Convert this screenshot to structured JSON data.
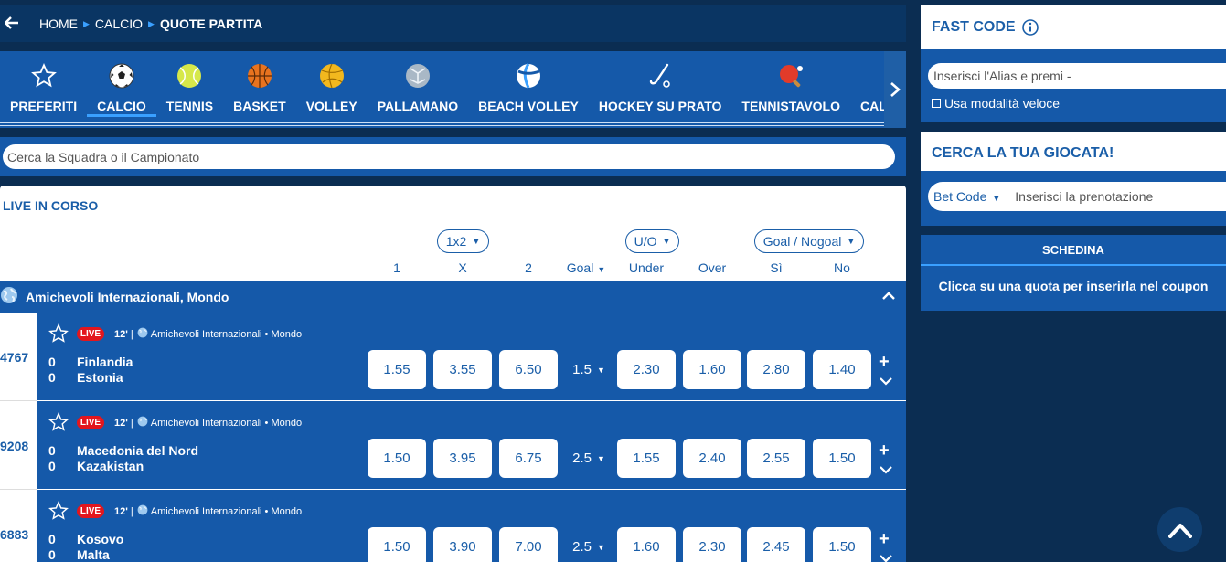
{
  "breadcrumb": {
    "back_icon": "arrow-left-icon",
    "items": [
      "HOME",
      "CALCIO",
      "QUOTE PARTITA"
    ]
  },
  "sports": [
    {
      "label": "PREFERITI",
      "icon": "star-icon"
    },
    {
      "label": "CALCIO",
      "icon": "soccer-ball-icon"
    },
    {
      "label": "TENNIS",
      "icon": "tennis-ball-icon"
    },
    {
      "label": "BASKET",
      "icon": "basketball-icon"
    },
    {
      "label": "VOLLEY",
      "icon": "volleyball-icon"
    },
    {
      "label": "PALLAMANO",
      "icon": "handball-icon"
    },
    {
      "label": "BEACH VOLLEY",
      "icon": "beach-volley-icon"
    },
    {
      "label": "HOCKEY SU PRATO",
      "icon": "hockey-stick-icon"
    },
    {
      "label": "TENNISTAVOLO",
      "icon": "ping-pong-icon"
    },
    {
      "label": "CALENDARIO",
      "icon": "calendar-icon"
    }
  ],
  "active_sport": "CALCIO",
  "search": {
    "placeholder": "Cerca la Squadra o il Campionato"
  },
  "live": {
    "title": "LIVE IN CORSO",
    "market_selectors": [
      "1x2",
      "U/O",
      "Goal / Nogoal"
    ],
    "columns": [
      "1",
      "X",
      "2",
      "Goal",
      "Under",
      "Over",
      "Sì",
      "No"
    ],
    "league": "Amichevoli Internazionali, Mondo",
    "live_badge": "LIVE",
    "events": [
      {
        "id": "4767",
        "minute": "12'",
        "sep": "|",
        "competition": "Amichevoli Internazionali",
        "dot": "•",
        "region": "Mondo",
        "score_home": "0",
        "score_away": "0",
        "home": "Finlandia",
        "away": "Estonia",
        "odds": [
          "1.55",
          "3.55",
          "6.50"
        ],
        "line": "1.5",
        "uo": [
          "2.30",
          "1.60"
        ],
        "gng": [
          "2.80",
          "1.40"
        ]
      },
      {
        "id": "9208",
        "minute": "12'",
        "sep": "|",
        "competition": "Amichevoli Internazionali",
        "dot": "•",
        "region": "Mondo",
        "score_home": "0",
        "score_away": "0",
        "home": "Macedonia del Nord",
        "away": "Kazakistan",
        "odds": [
          "1.50",
          "3.95",
          "6.75"
        ],
        "line": "2.5",
        "uo": [
          "1.55",
          "2.40"
        ],
        "gng": [
          "2.55",
          "1.50"
        ]
      },
      {
        "id": "6883",
        "minute": "12'",
        "sep": "|",
        "competition": "Amichevoli Internazionali",
        "dot": "•",
        "region": "Mondo",
        "score_home": "0",
        "score_away": "0",
        "home": "Kosovo",
        "away": "Malta",
        "odds": [
          "1.50",
          "3.90",
          "7.00"
        ],
        "line": "2.5",
        "uo": [
          "1.60",
          "2.30"
        ],
        "gng": [
          "2.45",
          "1.50"
        ]
      }
    ],
    "plus_label": "+"
  },
  "fast_code": {
    "title": "FAST CODE",
    "placeholder": "Inserisci l'Alias e premi -",
    "checkbox_label": "Usa modalità veloce"
  },
  "cerca_giocata": {
    "title": "CERCA LA TUA GIOCATA!",
    "select_value": "Bet Code",
    "placeholder": "Inserisci la prenotazione"
  },
  "schedina": {
    "title": "SCHEDINA",
    "message": "Clicca su una quota per inserirla nel coupon"
  },
  "colors": {
    "brand_blue": "#1559a9",
    "dark_navy": "#0b2d52",
    "accent": "#3aa0ff",
    "live_red": "#e3161d"
  }
}
